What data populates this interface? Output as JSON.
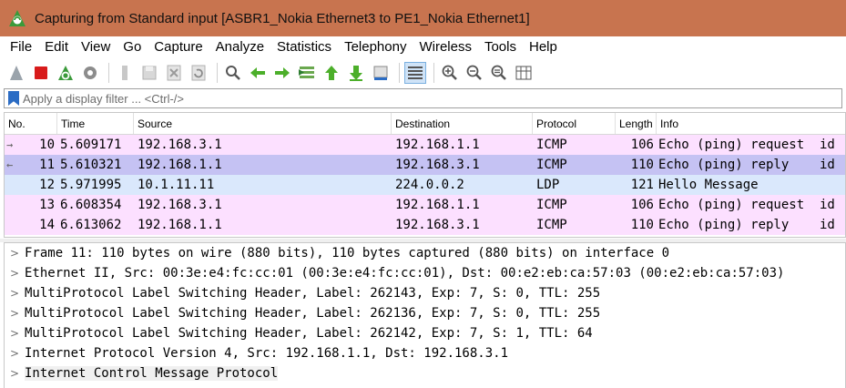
{
  "window": {
    "title": "Capturing from Standard input [ASBR1_Nokia Ethernet3 to PE1_Nokia Ethernet1]"
  },
  "menu": [
    "File",
    "Edit",
    "View",
    "Go",
    "Capture",
    "Analyze",
    "Statistics",
    "Telephony",
    "Wireless",
    "Tools",
    "Help"
  ],
  "toolbar": {
    "buttons": [
      "start-capture-icon",
      "stop-capture-icon",
      "restart-capture-icon",
      "capture-options-icon",
      "open-file-icon",
      "save-file-icon",
      "close-file-icon",
      "reload-file-icon",
      "find-packet-icon",
      "go-back-icon",
      "go-forward-icon",
      "go-to-packet-icon",
      "go-first-icon",
      "go-last-icon",
      "autoscroll-icon",
      "colorize-icon",
      "zoom-in-icon",
      "zoom-out-icon",
      "zoom-normal-icon",
      "resize-columns-icon"
    ]
  },
  "filter": {
    "placeholder": "Apply a display filter ... <Ctrl-/>"
  },
  "packet_list": {
    "columns": {
      "no": "No.",
      "time": "Time",
      "source": "Source",
      "destination": "Destination",
      "protocol": "Protocol",
      "length": "Length",
      "info": "Info"
    },
    "rows": [
      {
        "no": "10",
        "time": "5.609171",
        "source": "192.168.3.1",
        "destination": "192.168.1.1",
        "protocol": "ICMP",
        "length": "106",
        "info": "Echo (ping) request  id",
        "bg": "#fce0ff",
        "arrow": "→"
      },
      {
        "no": "11",
        "time": "5.610321",
        "source": "192.168.1.1",
        "destination": "192.168.3.1",
        "protocol": "ICMP",
        "length": "110",
        "info": "Echo (ping) reply    id",
        "bg": "#c5c2f3",
        "arrow": "←"
      },
      {
        "no": "12",
        "time": "5.971995",
        "source": "10.1.11.11",
        "destination": "224.0.0.2",
        "protocol": "LDP",
        "length": "121",
        "info": "Hello Message",
        "bg": "#dae8fc",
        "arrow": ""
      },
      {
        "no": "13",
        "time": "6.608354",
        "source": "192.168.3.1",
        "destination": "192.168.1.1",
        "protocol": "ICMP",
        "length": "106",
        "info": "Echo (ping) request  id",
        "bg": "#fce0ff",
        "arrow": ""
      },
      {
        "no": "14",
        "time": "6.613062",
        "source": "192.168.1.1",
        "destination": "192.168.3.1",
        "protocol": "ICMP",
        "length": "110",
        "info": "Echo (ping) reply    id",
        "bg": "#fce0ff",
        "arrow": ""
      }
    ]
  },
  "details": [
    "Frame 11: 110 bytes on wire (880 bits), 110 bytes captured (880 bits) on interface 0",
    "Ethernet II, Src: 00:3e:e4:fc:cc:01 (00:3e:e4:fc:cc:01), Dst: 00:e2:eb:ca:57:03 (00:e2:eb:ca:57:03)",
    "MultiProtocol Label Switching Header, Label: 262143, Exp: 7, S: 0, TTL: 255",
    "MultiProtocol Label Switching Header, Label: 262136, Exp: 7, S: 0, TTL: 255",
    "MultiProtocol Label Switching Header, Label: 262142, Exp: 7, S: 1, TTL: 64",
    "Internet Protocol Version 4, Src: 192.168.1.1, Dst: 192.168.3.1",
    "Internet Control Message Protocol"
  ],
  "colors": {
    "titlebar": "#c8744f",
    "icmp_row": "#fce0ff",
    "selected_row": "#c5c2f3",
    "ldp_row": "#dae8fc"
  }
}
